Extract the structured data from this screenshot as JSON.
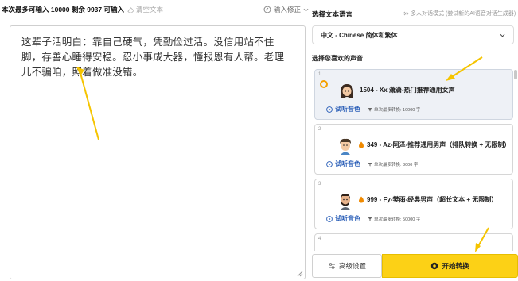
{
  "left_panel": {
    "limit_text": "本次最多可输入 10000 剩余 9937 可输入",
    "clear_label": "清空文本",
    "input_fix_label": "输入修正",
    "editor_text": "这辈子活明白：靠自己硬气，凭勤俭过活。没信用站不住脚，存善心睡得安稳。忍小事成大器，懂报恩有人帮。老理儿不骗咱，照着做准没错。"
  },
  "right_panel": {
    "lang_heading": "选择文本语言",
    "multi_mode_label": "多人对话模式 (尝试新的AI语音对话生成器)",
    "selected_language": "中文 - Chinese 简体和繁体",
    "voice_heading": "选择您喜欢的声音",
    "voices": [
      {
        "index": "1",
        "name": "1504 - Xx 潇潇-热门推荐通用女声",
        "listen": "试听音色",
        "max": "单次最多转换: 10000 字",
        "selected": true
      },
      {
        "index": "2",
        "name": "349 - Az-阿泽-推荐通用男声（排队转换 + 无限制）",
        "listen": "试听音色",
        "max": "单次最多转换: 3000 字",
        "selected": false
      },
      {
        "index": "3",
        "name": "999 - Fy-樊雨-经典男声（超长文本 + 无限制）",
        "listen": "试听音色",
        "max": "单次最多转换: 50000 字",
        "selected": false
      },
      {
        "index": "4"
      }
    ],
    "advanced_label": "高级设置",
    "start_label": "开始转换"
  },
  "colors": {
    "accent_yellow": "#fcd116",
    "radio_orange": "#f5a000",
    "link_blue": "#2b5fb8",
    "selected_card_bg": "#eef1f6"
  },
  "icons": [
    "eraser-icon",
    "edit-icon",
    "chevron-down-icon",
    "link-icon",
    "radio-selected-icon",
    "avatar-icon",
    "flame-icon",
    "play-icon",
    "filter-icon",
    "settings-icon",
    "start-icon"
  ]
}
